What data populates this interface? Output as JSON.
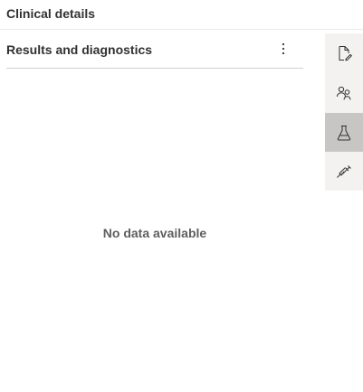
{
  "header": {
    "title": "Clinical details"
  },
  "panel": {
    "title": "Results and diagnostics",
    "more_icon": "more-vertical-icon",
    "empty_message": "No data available"
  },
  "side_rail": {
    "items": [
      {
        "icon": "document-edit-icon",
        "active": false
      },
      {
        "icon": "people-icon",
        "active": false
      },
      {
        "icon": "flask-icon",
        "active": true
      },
      {
        "icon": "syringe-icon",
        "active": false
      }
    ]
  }
}
